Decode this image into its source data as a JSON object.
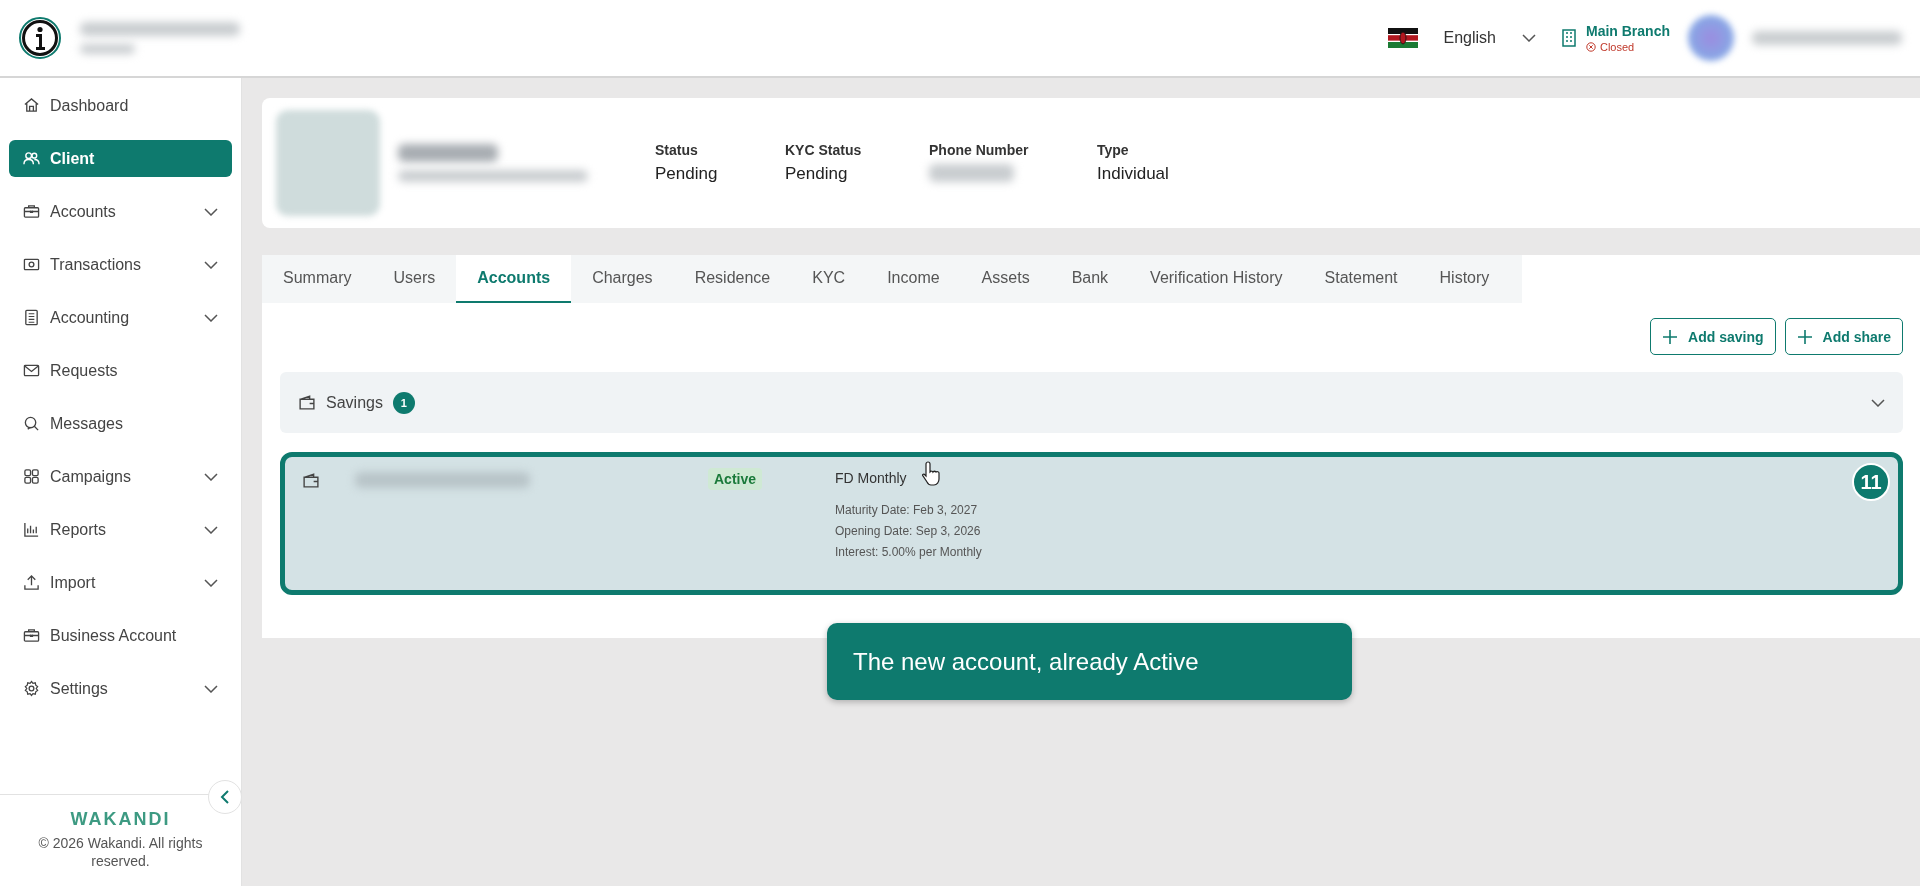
{
  "header": {
    "language": "English",
    "branch": {
      "name": "Main Branch",
      "status": "Closed"
    }
  },
  "sidebar": {
    "items": [
      {
        "label": "Dashboard",
        "selected": false,
        "has_submenu": false
      },
      {
        "label": "Client",
        "selected": true,
        "has_submenu": false
      },
      {
        "label": "Accounts",
        "selected": false,
        "has_submenu": true
      },
      {
        "label": "Transactions",
        "selected": false,
        "has_submenu": true
      },
      {
        "label": "Accounting",
        "selected": false,
        "has_submenu": true
      },
      {
        "label": "Requests",
        "selected": false,
        "has_submenu": false
      },
      {
        "label": "Messages",
        "selected": false,
        "has_submenu": false
      },
      {
        "label": "Campaigns",
        "selected": false,
        "has_submenu": true
      },
      {
        "label": "Reports",
        "selected": false,
        "has_submenu": true
      },
      {
        "label": "Import",
        "selected": false,
        "has_submenu": true
      },
      {
        "label": "Business Account",
        "selected": false,
        "has_submenu": false
      },
      {
        "label": "Settings",
        "selected": false,
        "has_submenu": true
      }
    ],
    "brand": "WAKANDI",
    "copyright": "© 2026 Wakandi. All rights reserved."
  },
  "client": {
    "fields": [
      {
        "label": "Status",
        "value": "Pending"
      },
      {
        "label": "KYC Status",
        "value": "Pending"
      },
      {
        "label": "Phone Number"
      },
      {
        "label": "Type",
        "value": "Individual"
      }
    ]
  },
  "tabs": [
    {
      "label": "Summary",
      "selected": false
    },
    {
      "label": "Users",
      "selected": false
    },
    {
      "label": "Accounts",
      "selected": true
    },
    {
      "label": "Charges",
      "selected": false
    },
    {
      "label": "Residence",
      "selected": false
    },
    {
      "label": "KYC",
      "selected": false
    },
    {
      "label": "Income",
      "selected": false
    },
    {
      "label": "Assets",
      "selected": false
    },
    {
      "label": "Bank",
      "selected": false
    },
    {
      "label": "Verification History",
      "selected": false
    },
    {
      "label": "Statement",
      "selected": false
    },
    {
      "label": "History",
      "selected": false
    }
  ],
  "buttons": [
    "Add saving",
    "Add share"
  ],
  "savings": {
    "title": "Savings",
    "count": "1",
    "expanded": true,
    "accounts": [
      {
        "status": "Active",
        "product": "FD Monthly",
        "details": [
          "Maturity Date: Feb 3, 2027",
          "Opening Date: Sep 3, 2026",
          "Interest: 5.00% per Monthly"
        ],
        "highlighted": true
      }
    ]
  },
  "callout": {
    "step": "11",
    "text": "The new account, already Active"
  }
}
